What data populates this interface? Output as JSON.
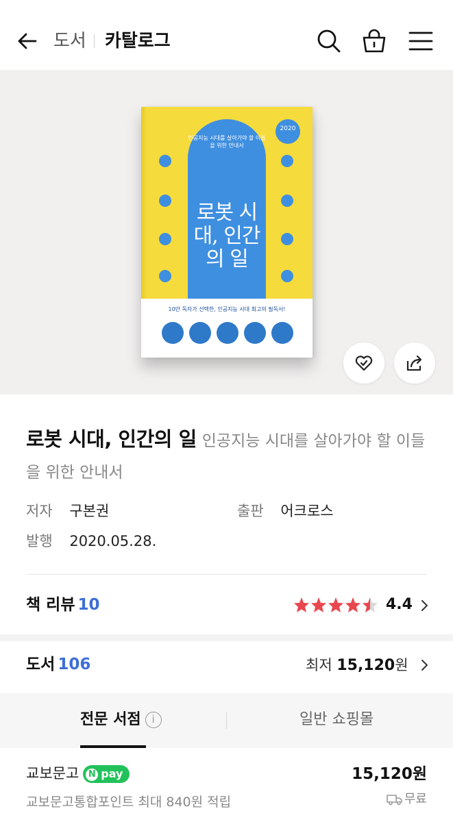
{
  "header": {
    "crumb_category": "도서",
    "crumb_current": "카탈로그"
  },
  "cover": {
    "arch_subtitle": "인공지능 시대를 살아가야 할 이들을 위한 안내서",
    "arch_title": "로봇 시대, 인간의 일",
    "edition_badge": "2020",
    "bottom_tagline": "10만 독자가 선택한, 인공지능 시대 최고의 필독서!",
    "accent_color": "#3f8fe0",
    "cover_color": "#f6db3c"
  },
  "book": {
    "title": "로봇 시대, 인간의 일",
    "subtitle": "인공지능 시대를 살아가야 할 이들을 위한 안내서",
    "author_label": "저자",
    "author": "구본권",
    "publisher_label": "출판",
    "publisher": "어크로스",
    "published_label": "발행",
    "published": "2020.05.28."
  },
  "review": {
    "label": "책 리뷰",
    "count": "10",
    "rating": "4.4",
    "rating_value": 4.4,
    "rating_max": 5
  },
  "listing": {
    "label": "도서",
    "count": "106",
    "lowest_label": "최저",
    "lowest_price": "15,120",
    "won": "원"
  },
  "tabs": {
    "specialty": "전문 서점",
    "general": "일반 쇼핑몰",
    "info_glyph": "i"
  },
  "seller": {
    "name": "교보문고",
    "npay": "pay",
    "npay_n": "N",
    "price": "15,120원",
    "points": "교보문고통합포인트 최대 840원 적립",
    "shipping": "무료"
  },
  "colors": {
    "link_blue": "#3d6fd6",
    "star_red": "#e8474f",
    "npay_green": "#22c25a"
  }
}
